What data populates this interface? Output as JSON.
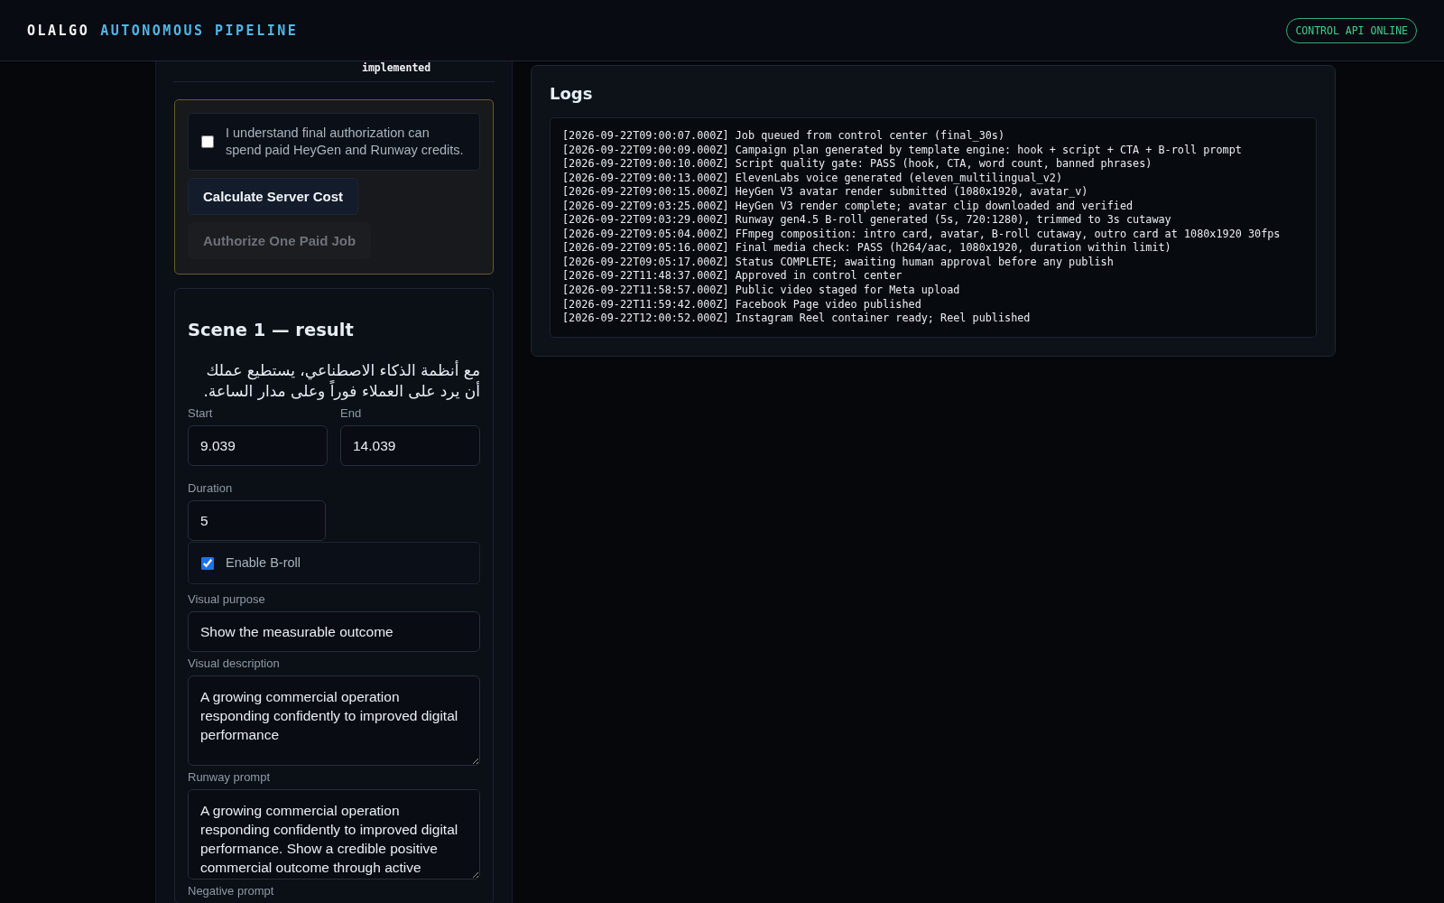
{
  "header": {
    "brand": "OLALGO",
    "title": "AUTONOMOUS PIPELINE",
    "status_badge": "CONTROL API ONLINE"
  },
  "previous_card": {
    "text": "implemented"
  },
  "authorization": {
    "consent": {
      "label": "I understand final authorization can spend paid HeyGen and Runway credits.",
      "checked": false
    },
    "buttons": [
      {
        "label": "Calculate Server Cost",
        "disabled": false
      },
      {
        "label": "Authorize One Paid Job",
        "disabled": true
      }
    ]
  },
  "scene": {
    "title": "Scene 1 — result",
    "script": "مع أنظمة الذكاء الاصطناعي، يستطيع عملك أن يرد على العملاء فوراً وعلى مدار الساعة.",
    "start": {
      "label": "Start",
      "value": "9.039"
    },
    "end": {
      "label": "End",
      "value": "14.039"
    },
    "duration": {
      "label": "Duration",
      "value": "5"
    },
    "broll": {
      "label": "Enable B-roll",
      "checked": true
    },
    "visual_purpose": {
      "label": "Visual purpose",
      "value": "Show the measurable outcome"
    },
    "visual_description": {
      "label": "Visual description",
      "value": "A growing commercial operation responding confidently to improved digital performance"
    },
    "runway_prompt": {
      "label": "Runway prompt",
      "value": "A growing commercial operation responding confidently to improved digital performance. Show a credible positive commercial outcome through active"
    },
    "negative_prompt": {
      "label": "Negative prompt"
    }
  },
  "logs": {
    "title": "Logs",
    "lines": [
      "[2026-09-22T09:00:07.000Z] Job queued from control center (final_30s)",
      "[2026-09-22T09:00:09.000Z] Campaign plan generated by template engine: hook + script + CTA + B-roll prompt",
      "[2026-09-22T09:00:10.000Z] Script quality gate: PASS (hook, CTA, word count, banned phrases)",
      "[2026-09-22T09:00:13.000Z] ElevenLabs voice generated (eleven_multilingual_v2)",
      "[2026-09-22T09:00:15.000Z] HeyGen V3 avatar render submitted (1080x1920, avatar_v)",
      "[2026-09-22T09:03:25.000Z] HeyGen V3 render complete; avatar clip downloaded and verified",
      "[2026-09-22T09:03:29.000Z] Runway gen4.5 B-roll generated (5s, 720:1280), trimmed to 3s cutaway",
      "[2026-09-22T09:05:04.000Z] FFmpeg composition: intro card, avatar, B-roll cutaway, outro card at 1080x1920 30fps",
      "[2026-09-22T09:05:16.000Z] Final media check: PASS (h264/aac, 1080x1920, duration within limit)",
      "[2026-09-22T09:05:17.000Z] Status COMPLETE; awaiting human approval before any publish",
      "[2026-09-22T11:48:37.000Z] Approved in control center",
      "[2026-09-22T11:58:57.000Z] Public video staged for Meta upload",
      "[2026-09-22T11:59:42.000Z] Facebook Page video published",
      "[2026-09-22T12:00:52.000Z] Instagram Reel container ready; Reel published"
    ]
  }
}
